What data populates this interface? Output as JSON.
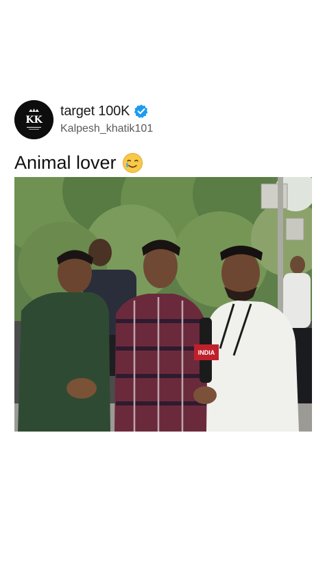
{
  "post": {
    "author": {
      "display_name": "target 100K",
      "handle": "Kalpesh_khatik101",
      "avatar_monogram": "KK",
      "avatar_icon": "crown-monogram-logo",
      "verified": true,
      "verified_icon": "verified-badge-icon"
    },
    "caption": {
      "text": "Animal lover",
      "emoji": "smiling-face-with-tear-emoji"
    },
    "media": {
      "type": "photo",
      "mic_flag_text": "INDIA",
      "content": "three young men and a reporter holding a microphone outdoors under trees"
    }
  },
  "colors": {
    "background": "#ffffff",
    "verified_blue": "#1d9bf0",
    "handle_gray": "#5a5a5a",
    "avatar_bg": "#0d0d0d",
    "mic_flag_red": "#c0202b"
  }
}
